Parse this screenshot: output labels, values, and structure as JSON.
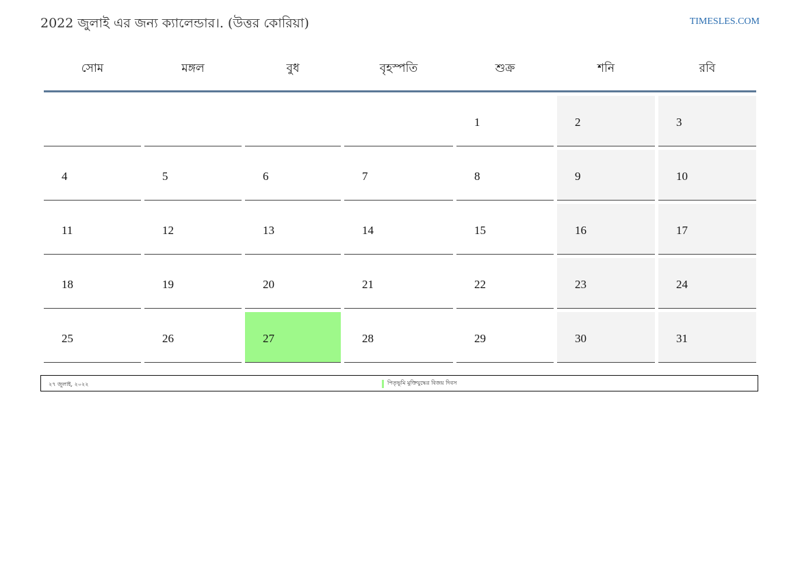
{
  "header": {
    "title": "2022 জুলাই এর জন্য ক্যালেন্ডার।. (উত্তর কোরিয়া)",
    "brand": "TIMESLES.COM"
  },
  "weekdays": [
    "সোম",
    "মঙ্গল",
    "বুধ",
    "বৃহস্পতি",
    "শুক্র",
    "শনি",
    "রবি"
  ],
  "weeks": [
    [
      "",
      "",
      "",
      "",
      "1",
      "2",
      "3"
    ],
    [
      "4",
      "5",
      "6",
      "7",
      "8",
      "9",
      "10"
    ],
    [
      "11",
      "12",
      "13",
      "14",
      "15",
      "16",
      "17"
    ],
    [
      "18",
      "19",
      "20",
      "21",
      "22",
      "23",
      "24"
    ],
    [
      "25",
      "26",
      "27",
      "28",
      "29",
      "30",
      "31"
    ]
  ],
  "holiday": {
    "day": "27",
    "date_label": "২৭ জুলাই, ২০২২",
    "name": "পিতৃভূমি মুক্তিযুদ্ধের বিজয় দিবস",
    "color": "#9ef98a"
  },
  "colors": {
    "weekend_bg": "#f3f3f3",
    "header_rule": "#5b7897",
    "brand": "#2a6db0"
  }
}
